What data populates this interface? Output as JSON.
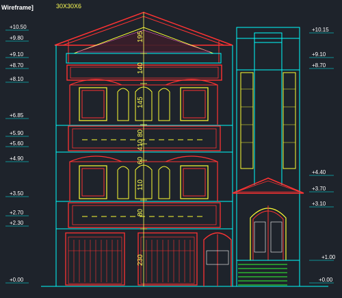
{
  "viewport_tab": "Wireframe]",
  "top_note": "30X30X6",
  "elevation_labels": {
    "left": [
      "+10.50",
      "+9.80",
      "+9.10",
      "+8.70",
      "+8.10",
      "+6.85",
      "+5.90",
      "+5.60",
      "+4.90",
      "+3.50",
      "+2.70",
      "+2.30",
      "+0.00"
    ],
    "right": [
      "+10.15",
      "+9.10",
      "+8.70",
      "+4.40",
      "+3.70",
      "+3.10",
      "+1.00",
      "+0.00"
    ]
  },
  "dimension_texts": [
    "195",
    "140",
    "145",
    "80",
    "410",
    "60",
    "110",
    "80",
    "230"
  ],
  "colors": {
    "background": "#1e232b",
    "outline": "#00ffff",
    "frame": "#ff2a2a",
    "window": "#ffff33",
    "dimension": "#ffff55",
    "stairs": "#33ff33",
    "roof_hatch": "#ff66cc"
  }
}
